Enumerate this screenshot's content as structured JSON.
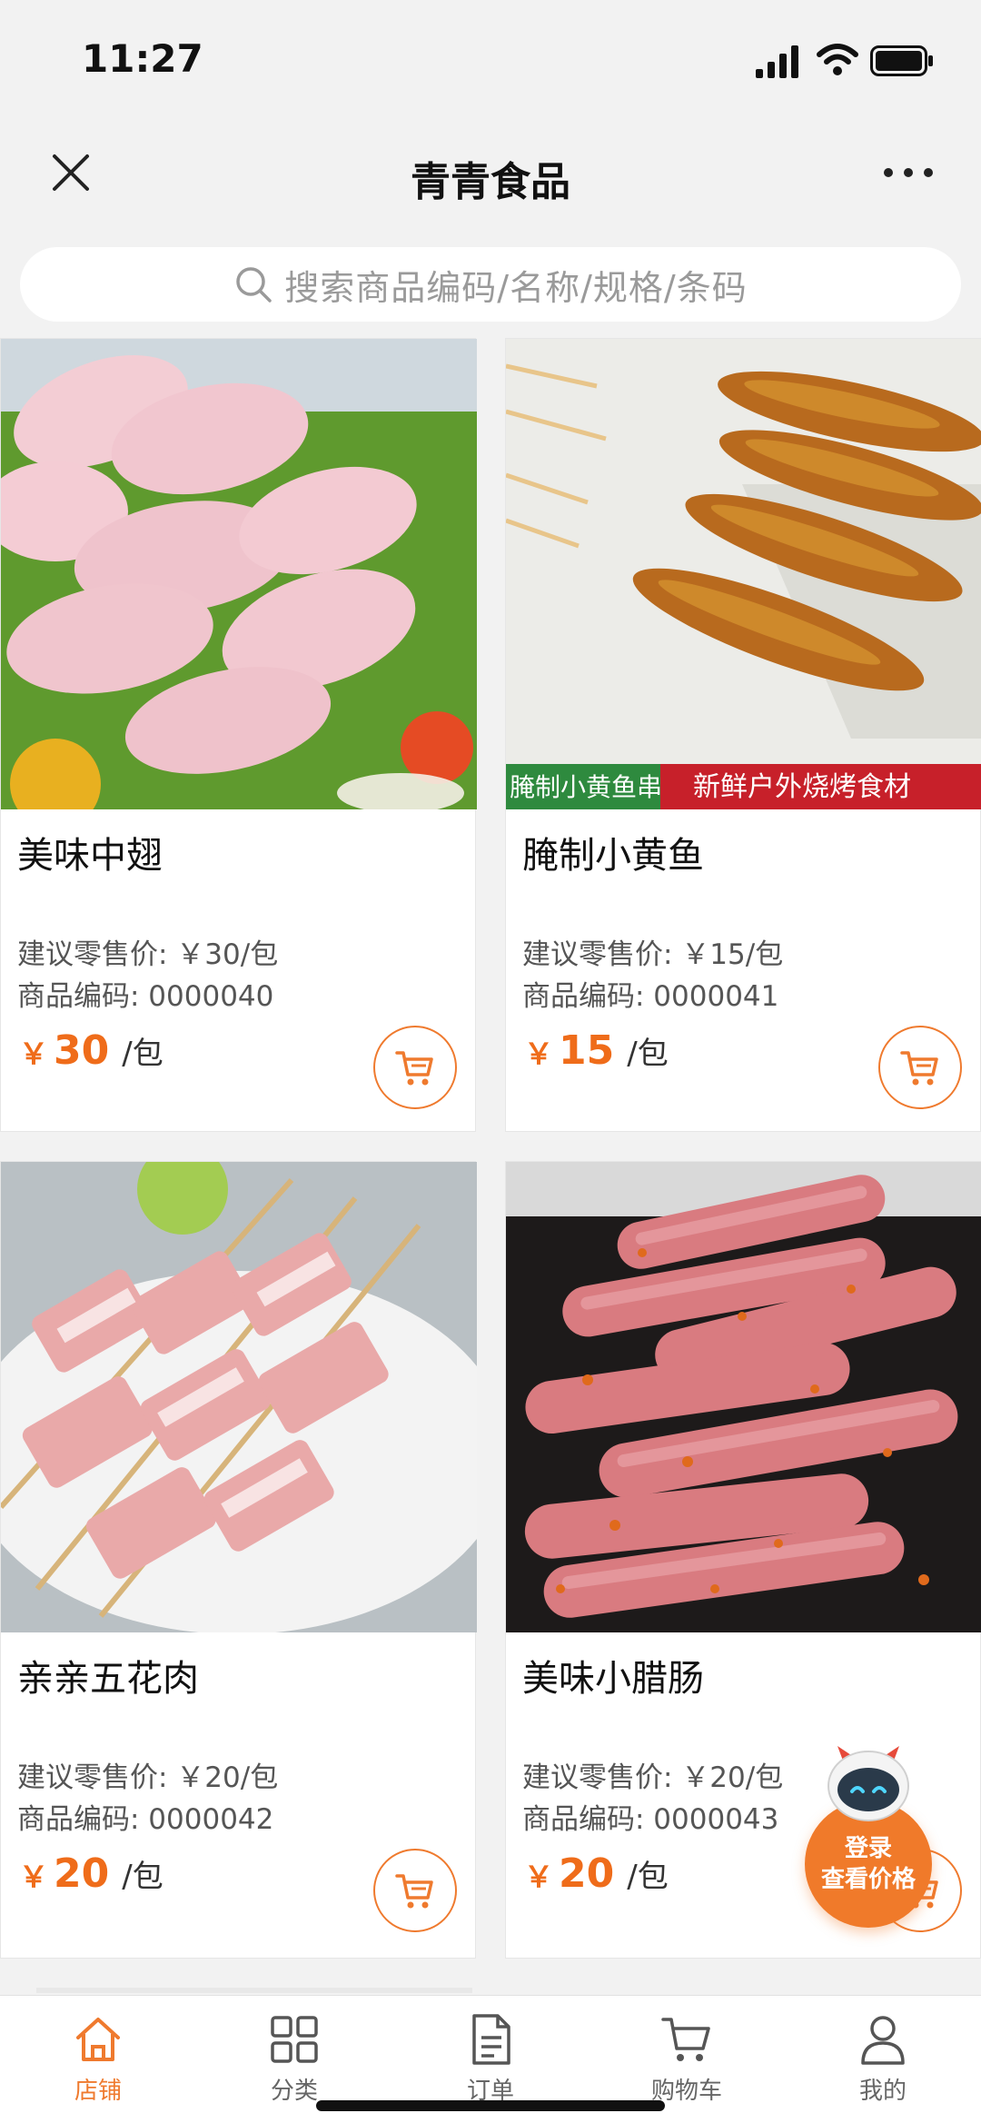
{
  "status_bar": {
    "time": "11:27"
  },
  "nav": {
    "title": "青青食品"
  },
  "search": {
    "placeholder": "搜索商品编码/名称/规格/条码"
  },
  "products": [
    {
      "name": "美味中翅",
      "retail": "建议零售价: ￥30/包",
      "code": "商品编码: 0000040",
      "currency": "￥",
      "price": "30",
      "unit": "/包"
    },
    {
      "name": "腌制小黄鱼",
      "retail": "建议零售价: ￥15/包",
      "code": "商品编码: 0000041",
      "currency": "￥",
      "price": "15",
      "unit": "/包",
      "image_banner_left": "腌制小黄鱼串",
      "image_banner_right": "新鲜户外烧烤食材"
    },
    {
      "name": "亲亲五花肉",
      "retail": "建议零售价: ￥20/包",
      "code": "商品编码: 0000042",
      "currency": "￥",
      "price": "20",
      "unit": "/包"
    },
    {
      "name": "美味小腊肠",
      "retail": "建议零售价: ￥20/包",
      "code": "商品编码: 0000043",
      "currency": "￥",
      "price": "20",
      "unit": "/包"
    }
  ],
  "login_float": {
    "line1": "登录",
    "line2": "查看价格"
  },
  "tabs": [
    {
      "label": "店铺",
      "icon": "store-icon",
      "active": true
    },
    {
      "label": "分类",
      "icon": "grid-icon",
      "active": false
    },
    {
      "label": "订单",
      "icon": "order-icon",
      "active": false
    },
    {
      "label": "购物车",
      "icon": "cart-icon",
      "active": false
    },
    {
      "label": "我的",
      "icon": "user-icon",
      "active": false
    }
  ],
  "colors": {
    "accent": "#ef7a2e",
    "price": "#ef6c1a",
    "background": "#f2f2f2"
  }
}
